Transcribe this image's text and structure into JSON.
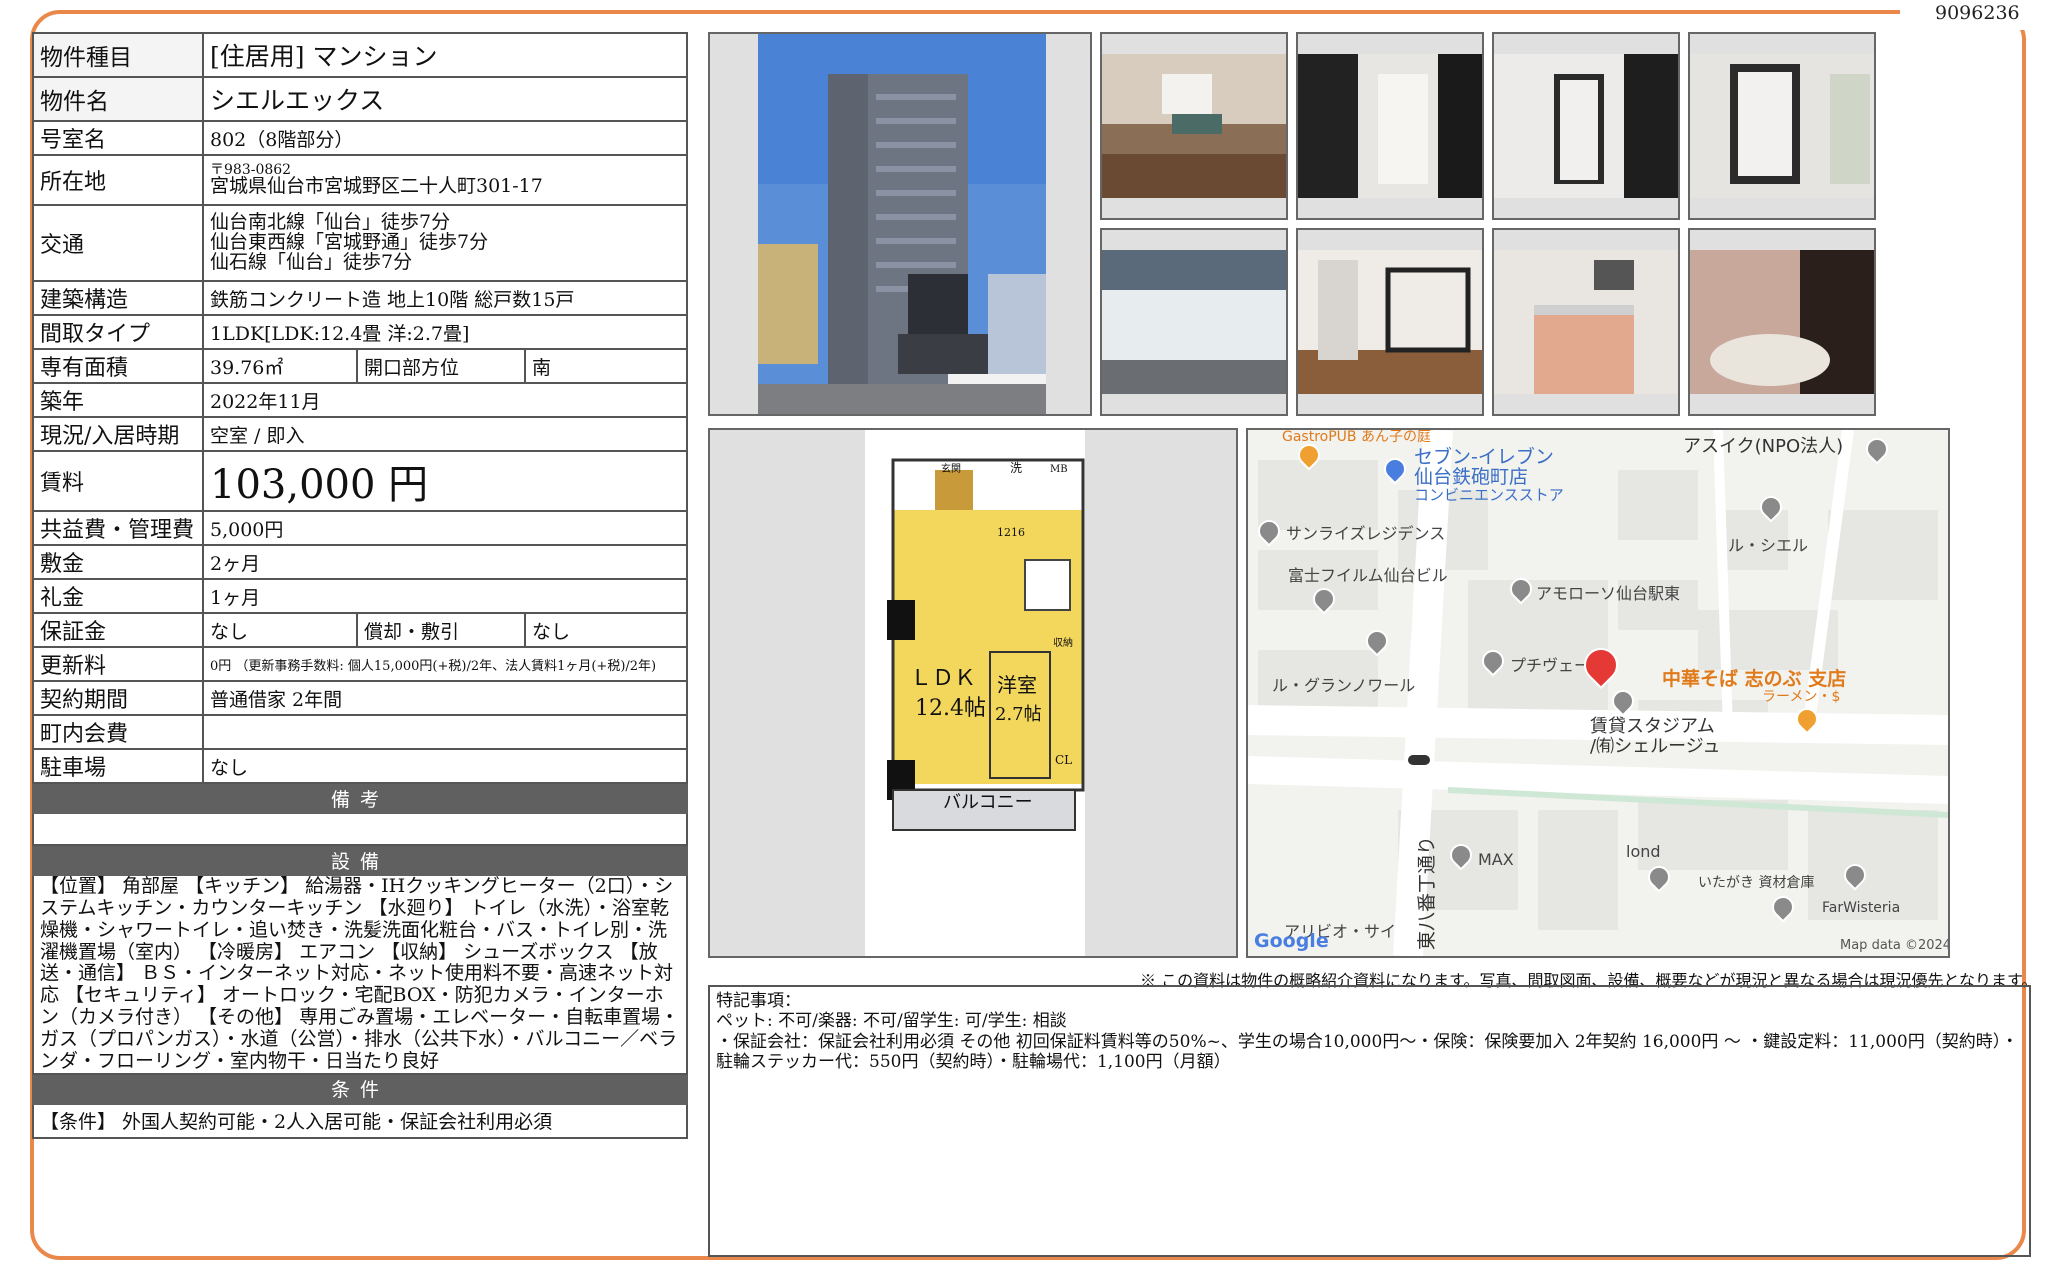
{
  "doc_id": "9096236",
  "property": {
    "type_label": "物件種目",
    "type_value": "[住居用] マンション",
    "name_label": "物件名",
    "name_value": "シエルエックス",
    "room_label": "号室名",
    "room_value": "802（8階部分）",
    "address_label": "所在地",
    "zip": "〒983-0862",
    "address": "宮城県仙台市宮城野区二十人町301-17",
    "access_label": "交通",
    "access": [
      "仙台南北線「仙台」徒歩7分",
      "仙台東西線「宮城野通」徒歩7分",
      "仙石線「仙台」徒歩7分"
    ],
    "structure_label": "建築構造",
    "structure_value": "鉄筋コンクリート造 地上10階 総戸数15戸",
    "layout_label": "間取タイプ",
    "layout_value": "1LDK[LDK:12.4畳 洋:2.7畳]",
    "area_label": "専有面積",
    "area_value": "39.76㎡",
    "direction_label": "開口部方位",
    "direction_value": "南",
    "built_label": "築年",
    "built_value": "2022年11月",
    "status_label": "現況/入居時期",
    "status_value": "空室 / 即入",
    "rent_label": "賃料",
    "rent_value": "103,000 円",
    "fee_label": "共益費・管理費",
    "fee_value": "5,000円",
    "deposit_label": "敷金",
    "deposit_value": "2ヶ月",
    "key_money_label": "礼金",
    "key_money_value": "1ヶ月",
    "guarantee_label": "保証金",
    "guarantee_value": "なし",
    "amortization_label": "償却・敷引",
    "amortization_value": "なし",
    "renewal_label": "更新料",
    "renewal_value": "0円 （更新事務手数料: 個人15,000円(+税)/2年、法人賃料1ヶ月(+税)/2年)",
    "contract_label": "契約期間",
    "contract_value": "普通借家 2年間",
    "town_fee_label": "町内会費",
    "town_fee_value": "",
    "parking_label": "駐車場",
    "parking_value": "なし"
  },
  "remarks_header": "備考",
  "remarks_value": "",
  "equipment_header": "設備",
  "equipment_text": "【位置】 角部屋 【キッチン】 給湯器・IHクッキングヒーター（2口）・システムキッチン・カウンターキッチン 【水廻り】 トイレ（水洗）・浴室乾燥機・シャワートイレ・追い焚き・洗髪洗面化粧台・バス・トイレ別・洗濯機置場（室内） 【冷暖房】 エアコン 【収納】 シューズボックス 【放送・通信】 ＢＳ・インターネット対応・ネット使用料不要・高速ネット対応 【セキュリティ】 オートロック・宅配BOX・防犯カメラ・インターホン（カメラ付き） 【その他】 専用ごみ置場・エレベーター・自転車置場・ガス（プロパンガス）・水道（公営）・排水（公共下水）・バルコニー／ベランダ・フローリング・室内物干・日当たり良好",
  "conditions_header": "条件",
  "conditions_text": "【条件】 外国人契約可能・2人入居可能・保証会社利用必須",
  "floorplan": {
    "entrance": "玄関",
    "wash": "洗",
    "mb": "MB",
    "bath_size": "1216",
    "ldk": "ＬＤＫ",
    "ldk_size": "12.4帖",
    "western": "洋室",
    "western_size": "2.7帖",
    "storage": "収納",
    "cl": "CL",
    "balcony": "バルコニー"
  },
  "map": {
    "labels": {
      "gastropub": "GastroPUB あん子の庭",
      "seven": "セブン-イレブン",
      "seven2": "仙台鉄砲町店",
      "seven3": "コンビニエンスストア",
      "askui": "アスイク(NPO法人)",
      "sunrise": "サンライズレジデンス",
      "fuji": "富士フイルム仙台ビル",
      "lecielle": "ル・シエル",
      "amorosso": "アモローソ仙台駅東",
      "grand": "ル・グランノワール",
      "petit": "プチヴェー",
      "ramen": "中華そば 志のぶ 支店",
      "ramen2": "ラーメン・$",
      "stadium": "賃貸スタジアム",
      "stadium2": "/㈲シェルージュ",
      "street": "東八番丁通り",
      "max": "MAX",
      "lond": "lond",
      "itagaki": "いたがき 資材倉庫",
      "farwisteria": "FarWisteria",
      "arivio": "アリビオ・サイ",
      "google": "Google",
      "mapdata": "Map data ©2024"
    }
  },
  "disclaimer": "※ この資料は物件の概略紹介資料になります。写真、間取図面、設備、概要などが現況と異なる場合は現況優先となります。",
  "notes": {
    "title": "特記事項：",
    "line1": "ペット: 不可/楽器: 不可/留学生: 可/学生: 相談",
    "line2": "・保証会社：保証会社利用必須 その他 初回保証料賃料等の50%~、学生の場合10,000円～・保険：保険要加入 2年契約 16,000円 ～ ・鍵設定料：11,000円（契約時）・駐輪ステッカー代：550円（契約時）・駐輪場代：1,100円（月額）"
  }
}
